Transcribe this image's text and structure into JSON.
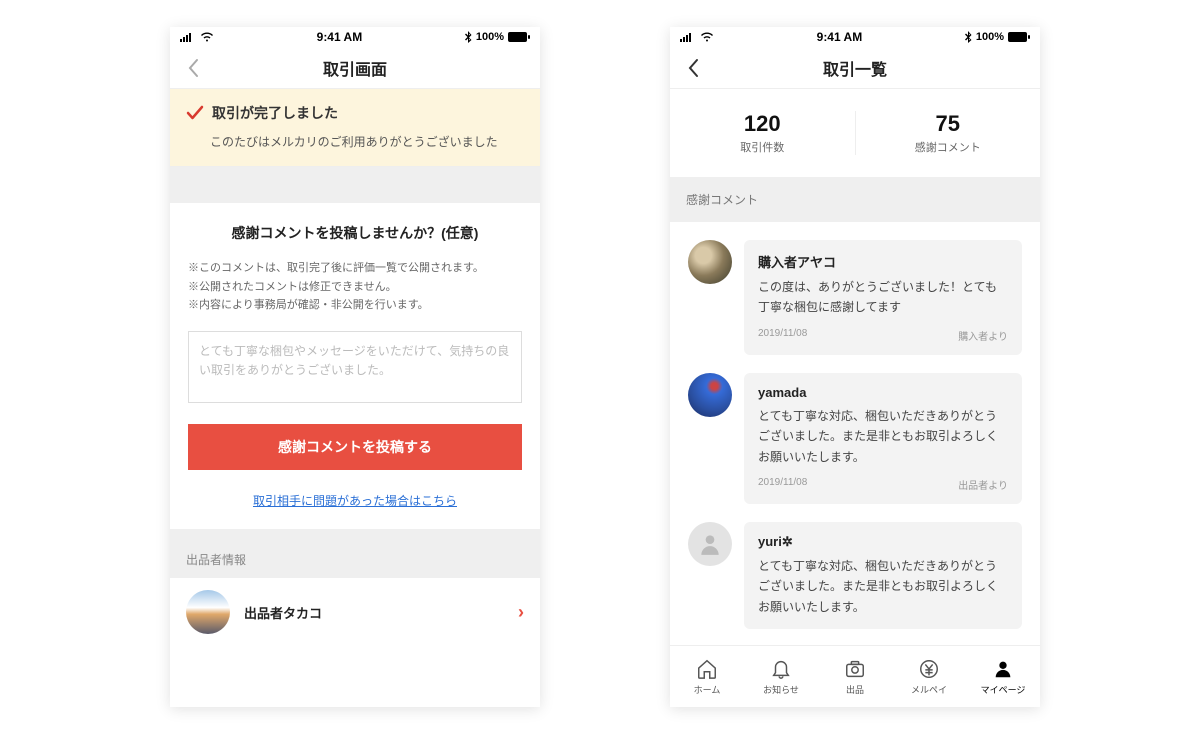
{
  "status_bar": {
    "time": "9:41 AM",
    "battery": "100%",
    "bluetooth_icon": "bluetooth-icon",
    "signal_icon": "signal-icon",
    "wifi_icon": "wifi-icon"
  },
  "left": {
    "header_title": "取引画面",
    "banner": {
      "title": "取引が完了しました",
      "subtitle": "このたびはメルカリのご利用ありがとうございました"
    },
    "section": {
      "title": "感謝コメントを投稿しませんか？(任意)",
      "note1": "※このコメントは、取引完了後に評価一覧で公開されます。",
      "note2": "※公開されたコメントは修正できません。",
      "note3": "※内容により事務局が確認・非公開を行います。",
      "placeholder": "とても丁寧な梱包やメッセージをいただけて、気持ちの良い取引をありがとうございました。",
      "submit_label": "感謝コメントを投稿する",
      "problem_link": "取引相手に問題があった場合はこちら"
    },
    "seller_section_label": "出品者情報",
    "seller_name": "出品者タカコ"
  },
  "right": {
    "header_title": "取引一覧",
    "stats": {
      "count_num": "120",
      "count_label": "取引件数",
      "thanks_num": "75",
      "thanks_label": "感謝コメント"
    },
    "list_header": "感謝コメント",
    "comments": [
      {
        "name": "購入者アヤコ",
        "text": "この度は、ありがとうございました！とても丁寧な梱包に感謝してます",
        "date": "2019/11/08",
        "role": "購入者より"
      },
      {
        "name": "yamada",
        "text": "とても丁寧な対応、梱包いただきありがとうございました。また是非ともお取引よろしくお願いいたします。",
        "date": "2019/11/08",
        "role": "出品者より"
      },
      {
        "name": "yuri✲",
        "text": "とても丁寧な対応、梱包いただきありがとうございました。また是非ともお取引よろしくお願いいたします。",
        "date": "",
        "role": ""
      }
    ],
    "tabs": {
      "home": "ホーム",
      "notify": "お知らせ",
      "post": "出品",
      "pay": "メルペイ",
      "mypage": "マイページ"
    }
  }
}
